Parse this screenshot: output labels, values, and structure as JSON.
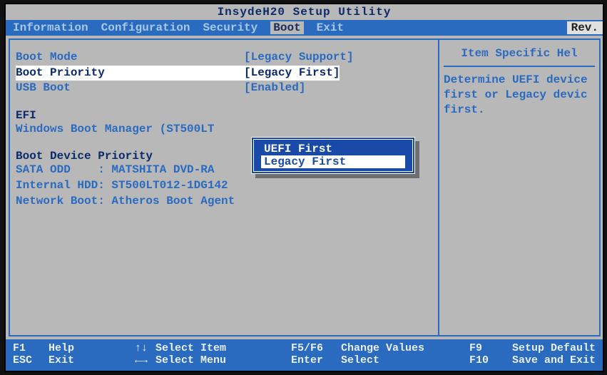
{
  "title": "InsydeH20 Setup Utility",
  "rev": "Rev.",
  "menu": {
    "items": [
      "Information",
      "Configuration",
      "Security",
      "Boot",
      "Exit"
    ],
    "active_index": 3
  },
  "settings": {
    "boot_mode": {
      "label": "Boot Mode",
      "value": "[Legacy Support]"
    },
    "boot_priority": {
      "label": "Boot Priority",
      "value": "[Legacy First]"
    },
    "usb_boot": {
      "label": "USB Boot",
      "value": "[Enabled]"
    }
  },
  "efi_section": {
    "header": "EFI",
    "entry": "Windows Boot Manager (ST500LT"
  },
  "boot_device_section": {
    "header": "Boot Device Priority",
    "rows": [
      "SATA ODD    : MATSHITA DVD-RA",
      "Internal HDD: ST500LT012-1DG142",
      "Network Boot: Atheros Boot Agent"
    ]
  },
  "popup": {
    "options": [
      "UEFI First",
      "Legacy First"
    ],
    "selected_index": 1
  },
  "help": {
    "title": "Item Specific Hel",
    "body": "Determine UEFI device\nfirst or Legacy devic\nfirst."
  },
  "footer": {
    "row1": {
      "k1": "F1",
      "l1": "Help",
      "a1": "↑↓",
      "l2": "Select Item",
      "k2": "F5/F6",
      "l3": "Change Values",
      "k3": "F9",
      "l4": "Setup Default"
    },
    "row2": {
      "k1": "ESC",
      "l1": "Exit",
      "a1": "←→",
      "l2": "Select Menu",
      "k2": "Enter",
      "l3": "Select",
      "k3": "F10",
      "l4": "Save and Exit"
    }
  }
}
